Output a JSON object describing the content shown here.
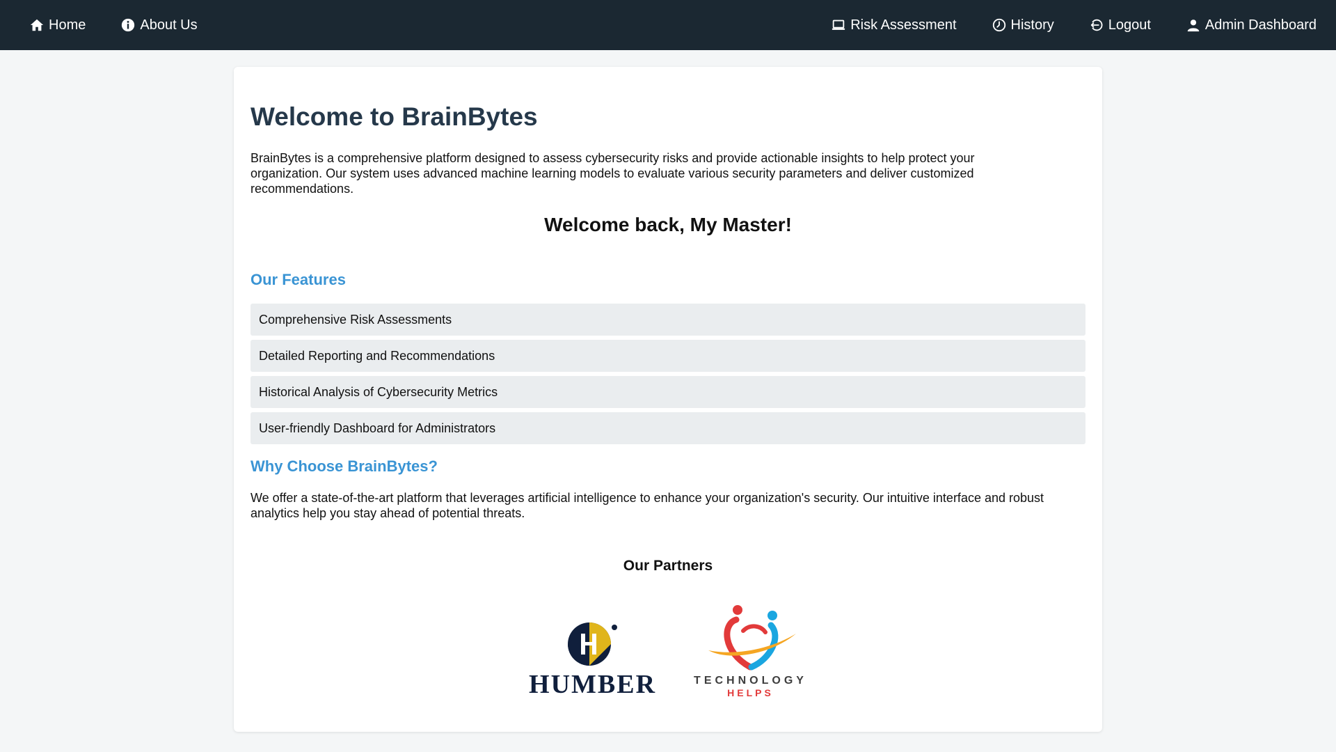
{
  "nav": {
    "left": [
      {
        "label": "Home",
        "icon": "home-icon"
      },
      {
        "label": "About Us",
        "icon": "info-icon"
      }
    ],
    "right": [
      {
        "label": "Risk Assessment",
        "icon": "laptop-icon"
      },
      {
        "label": "History",
        "icon": "history-icon"
      },
      {
        "label": "Logout",
        "icon": "logout-icon"
      },
      {
        "label": "Admin Dashboard",
        "icon": "user-icon"
      }
    ]
  },
  "main": {
    "title": "Welcome to BrainBytes",
    "intro": "BrainBytes is a comprehensive platform designed to assess cybersecurity risks and provide actionable insights to help protect your organization. Our system uses advanced machine learning models to evaluate various security parameters and deliver customized recommendations.",
    "welcome_back": "Welcome back, My Master!",
    "features_heading": "Our Features",
    "features": [
      "Comprehensive Risk Assessments",
      "Detailed Reporting and Recommendations",
      "Historical Analysis of Cybersecurity Metrics",
      "User-friendly Dashboard for Administrators"
    ],
    "why_heading": "Why Choose BrainBytes?",
    "why_text": "We offer a state-of-the-art platform that leverages artificial intelligence to enhance your organization's security. Our intuitive interface and robust analytics help you stay ahead of potential threats.",
    "partners_heading": "Our Partners",
    "partners": [
      {
        "name": "HUMBER",
        "icon": "humber-logo"
      },
      {
        "name_line1": "TECHNOLOGY",
        "name_line2": "HELPS",
        "icon": "technology-helps-logo"
      }
    ]
  },
  "colors": {
    "navbar": "#1b2832",
    "page_background": "#f4f6f7",
    "title": "#25384a",
    "accent_heading": "#3a94d4",
    "feature_background": "#eaedef"
  }
}
